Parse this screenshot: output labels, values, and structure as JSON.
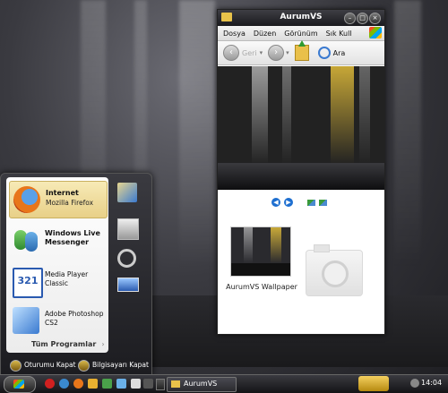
{
  "explorer": {
    "title": "AurumVS",
    "menu": [
      "Dosya",
      "Düzen",
      "Görünüm",
      "Sık Kull"
    ],
    "back_label": "Geri",
    "search_label": "Ara",
    "thumbnail_label": "AurumVS Wallpaper"
  },
  "start_menu": {
    "items": [
      {
        "name": "Internet",
        "sub": "Mozilla Firefox",
        "icon": "firefox-icon",
        "selected": true
      },
      {
        "name": "Windows Live Messenger",
        "sub": "",
        "icon": "messenger-icon",
        "selected": false
      },
      {
        "name": "Media Player Classic",
        "sub": "",
        "icon": "media-player-icon",
        "selected": false
      },
      {
        "name": "Adobe Photoshop CS2",
        "sub": "",
        "icon": "photoshop-icon",
        "selected": false
      }
    ],
    "all_programs": "Tüm Programlar",
    "logoff": "Oturumu Kapat",
    "shutdown": "Bilgisayarı Kapat",
    "right_icons": [
      "documents-icon",
      "computer-icon",
      "search-icon",
      "control-panel-icon"
    ]
  },
  "taskbar": {
    "task_label": "AurumVS",
    "clock": "14:04",
    "quick_launch": [
      "opera-icon",
      "ie-icon",
      "firefox-icon",
      "winamp-icon",
      "messenger-icon",
      "photoshop-icon",
      "mpc-icon",
      "foobar-icon"
    ]
  },
  "colors": {
    "accent": "#e8c24a",
    "selection": "#f0e0a0",
    "link_blue": "#1e6fd0"
  }
}
